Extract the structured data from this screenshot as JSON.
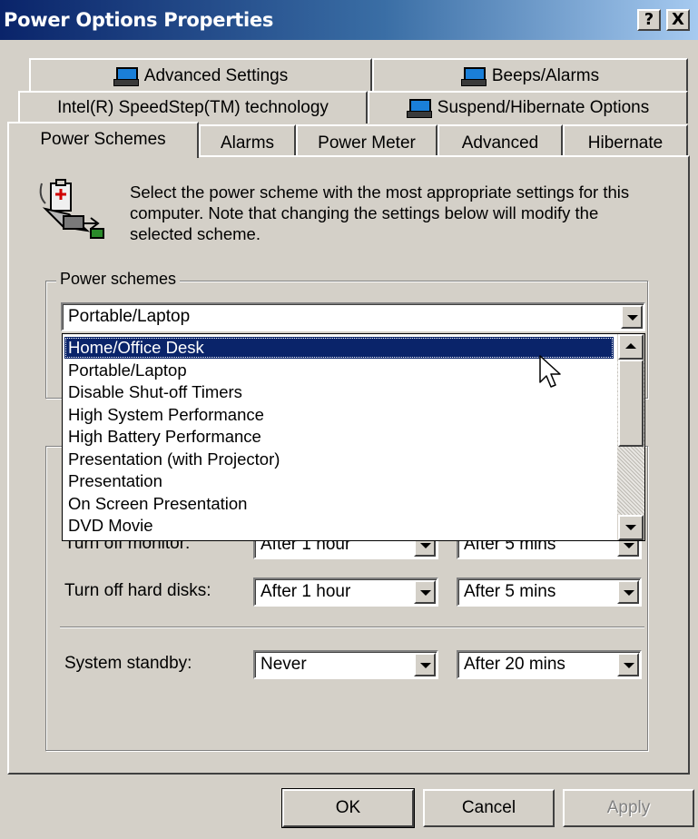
{
  "window": {
    "title": "Power Options Properties",
    "help_btn": "?",
    "close_btn": "X"
  },
  "tabs_row1": [
    {
      "label": "Advanced Settings",
      "icon": "laptop-icon"
    },
    {
      "label": "Beeps/Alarms",
      "icon": "laptop-icon"
    }
  ],
  "tabs_row2": [
    {
      "label": "Intel(R) SpeedStep(TM) technology"
    },
    {
      "label": "Suspend/Hibernate Options",
      "icon": "laptop-icon"
    }
  ],
  "tabs_row3": [
    {
      "label": "Power Schemes",
      "active": true
    },
    {
      "label": "Alarms"
    },
    {
      "label": "Power Meter"
    },
    {
      "label": "Advanced"
    },
    {
      "label": "Hibernate"
    }
  ],
  "description": "Select the power scheme with the most appropriate settings for this computer. Note that changing the settings below will modify the selected scheme.",
  "power_schemes": {
    "group_label": "Power schemes",
    "selected": "Portable/Laptop",
    "options": [
      "Home/Office Desk",
      "Portable/Laptop",
      "Disable Shut-off Timers",
      "High System Performance",
      "High Battery Performance",
      "Presentation (with Projector)",
      "Presentation",
      "On Screen Presentation",
      "DVD Movie"
    ],
    "highlighted": "Home/Office Desk"
  },
  "settings": {
    "monitor": {
      "label": "Turn off monitor:",
      "plugged": "After 1 hour",
      "battery": "After 5 mins"
    },
    "hard_disks": {
      "label": "Turn off hard disks:",
      "plugged": "After 1 hour",
      "battery": "After 5 mins"
    },
    "standby": {
      "label": "System standby:",
      "plugged": "Never",
      "battery": "After 20 mins"
    }
  },
  "buttons": {
    "ok": "OK",
    "cancel": "Cancel",
    "apply": "Apply"
  },
  "colors": {
    "titlebar_start": "#0a246a",
    "titlebar_end": "#a6caf0",
    "face": "#d4d0c8",
    "selection": "#0a246a"
  }
}
